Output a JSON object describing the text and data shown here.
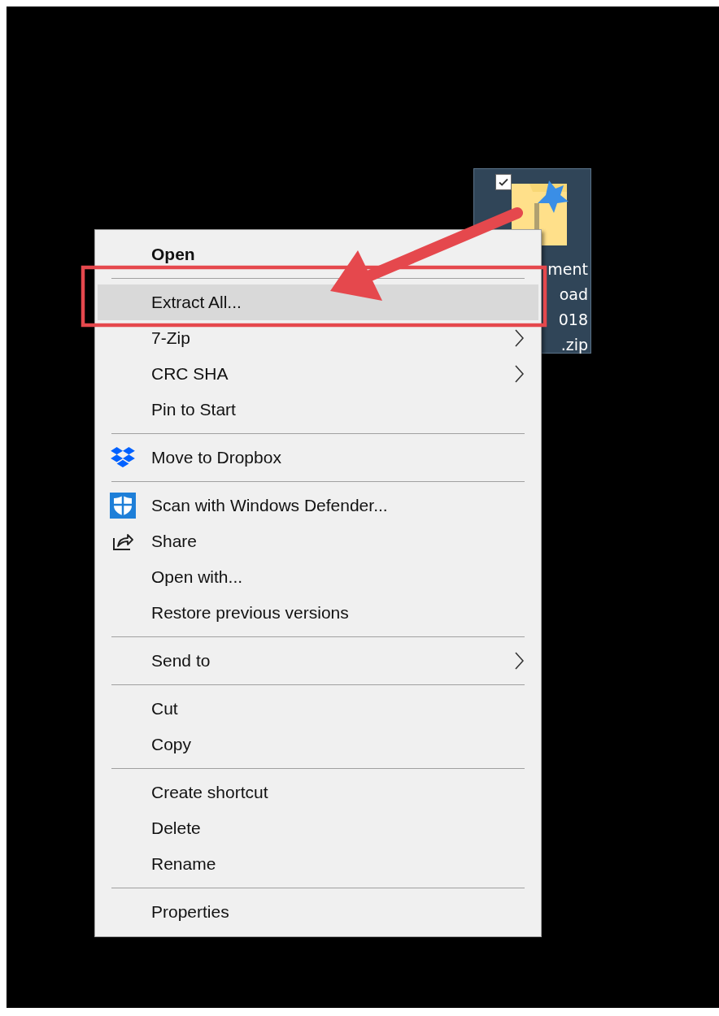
{
  "desktop_icon": {
    "selected": true,
    "checked": true,
    "label_lines": [
      "ment",
      "oad",
      "018",
      ".zip"
    ]
  },
  "context_menu": {
    "items": [
      {
        "kind": "item",
        "label": "Open",
        "bold": true,
        "selected": false,
        "submenu": false
      },
      {
        "kind": "separator"
      },
      {
        "kind": "item",
        "label": "Extract All...",
        "bold": false,
        "selected": true,
        "submenu": false
      },
      {
        "kind": "item",
        "label": "7-Zip",
        "bold": false,
        "selected": false,
        "submenu": true
      },
      {
        "kind": "item",
        "label": "CRC SHA",
        "bold": false,
        "selected": false,
        "submenu": true
      },
      {
        "kind": "item",
        "label": "Pin to Start",
        "bold": false,
        "selected": false,
        "submenu": false
      },
      {
        "kind": "separator"
      },
      {
        "kind": "dropbox",
        "label": "Move to Dropbox",
        "bold": false,
        "selected": false,
        "submenu": false
      },
      {
        "kind": "separator"
      },
      {
        "kind": "defender",
        "label": "Scan with Windows Defender...",
        "bold": false,
        "selected": false,
        "submenu": false
      },
      {
        "kind": "share",
        "label": "Share",
        "bold": false,
        "selected": false,
        "submenu": false
      },
      {
        "kind": "item",
        "label": "Open with...",
        "bold": false,
        "selected": false,
        "submenu": false
      },
      {
        "kind": "item",
        "label": "Restore previous versions",
        "bold": false,
        "selected": false,
        "submenu": false
      },
      {
        "kind": "separator"
      },
      {
        "kind": "item",
        "label": "Send to",
        "bold": false,
        "selected": false,
        "submenu": true
      },
      {
        "kind": "separator"
      },
      {
        "kind": "item",
        "label": "Cut",
        "bold": false,
        "selected": false,
        "submenu": false
      },
      {
        "kind": "item",
        "label": "Copy",
        "bold": false,
        "selected": false,
        "submenu": false
      },
      {
        "kind": "separator"
      },
      {
        "kind": "item",
        "label": "Create shortcut",
        "bold": false,
        "selected": false,
        "submenu": false
      },
      {
        "kind": "item",
        "label": "Delete",
        "bold": false,
        "selected": false,
        "submenu": false
      },
      {
        "kind": "item",
        "label": "Rename",
        "bold": false,
        "selected": false,
        "submenu": false
      },
      {
        "kind": "separator"
      },
      {
        "kind": "item",
        "label": "Properties",
        "bold": false,
        "selected": false,
        "submenu": false
      }
    ]
  }
}
